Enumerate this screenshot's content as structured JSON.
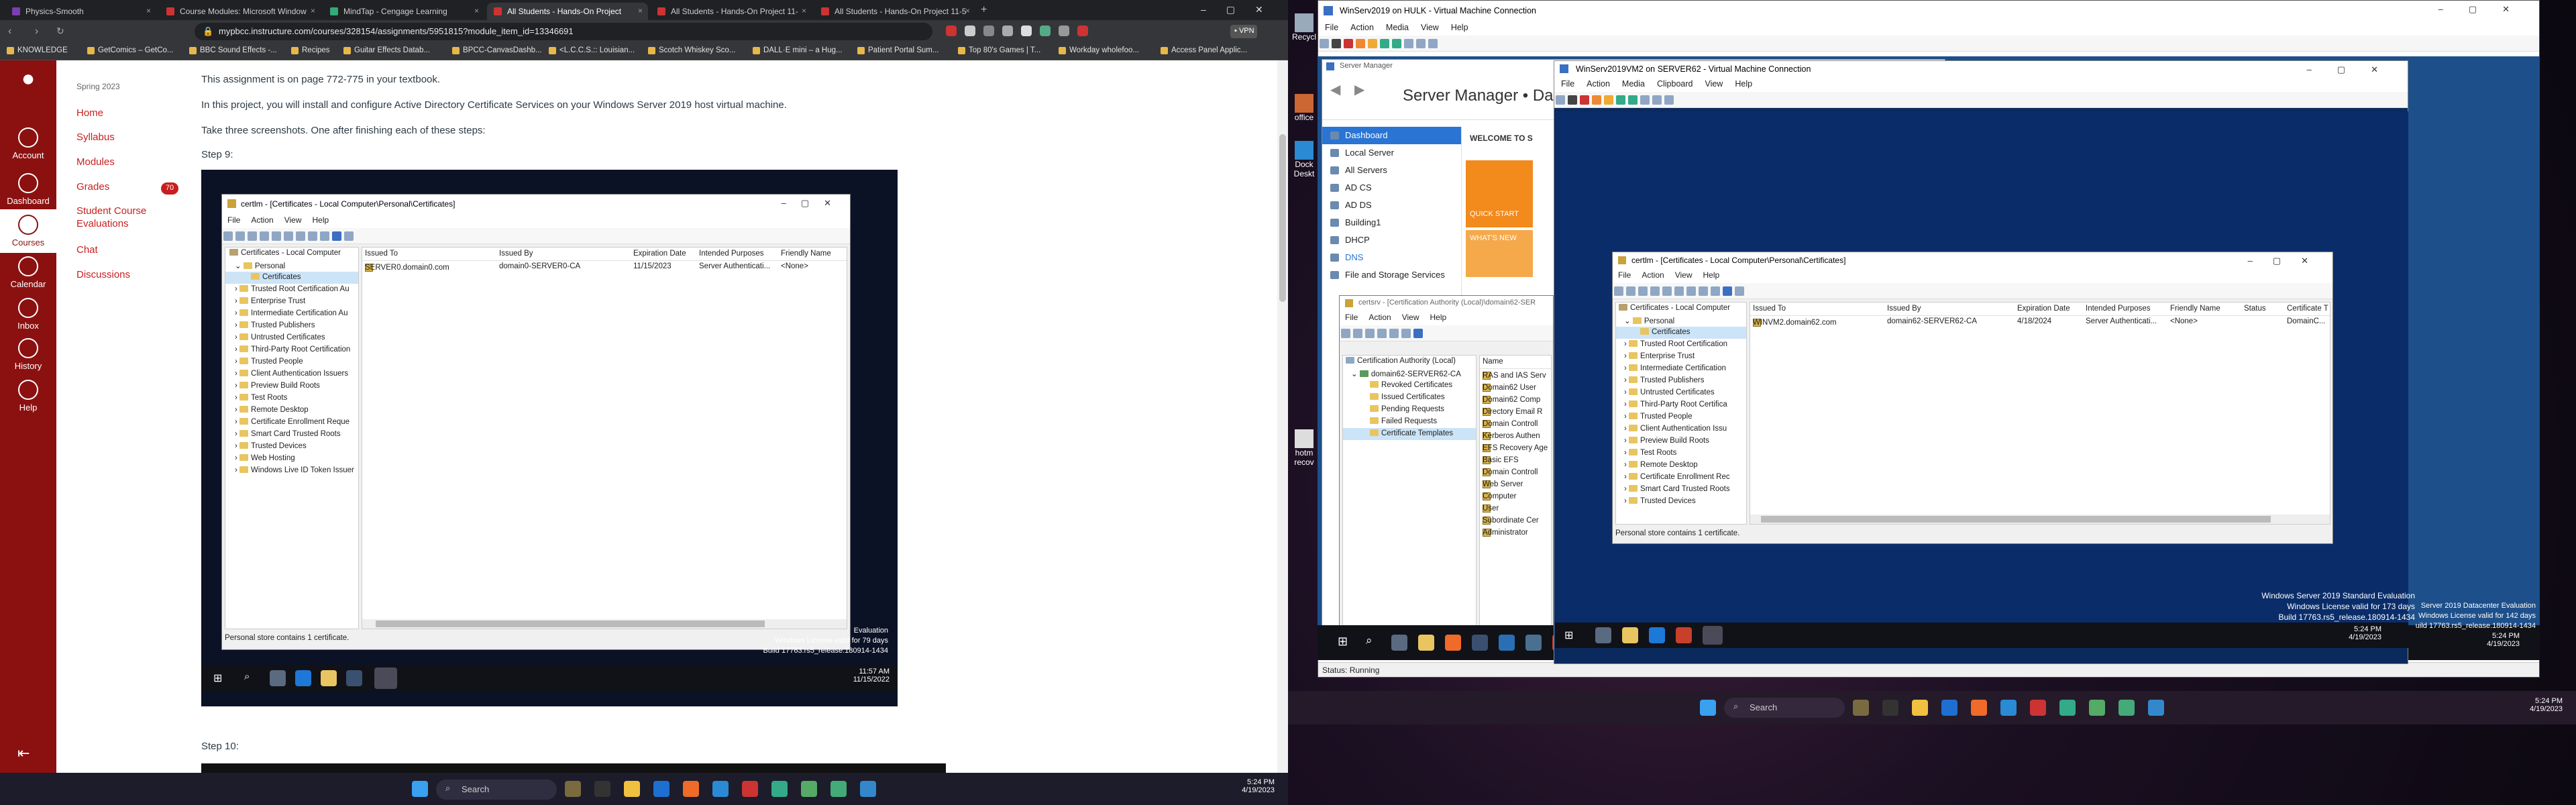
{
  "left_monitor": {
    "tabs": [
      {
        "label": "Physics-Smooth",
        "active": false
      },
      {
        "label": "Course Modules: Microsoft Window",
        "active": false
      },
      {
        "label": "MindTap - Cengage Learning",
        "active": false
      },
      {
        "label": "All Students - Hands-On Project",
        "active": true
      },
      {
        "label": "All Students - Hands-On Project 11-",
        "active": false
      },
      {
        "label": "All Students - Hands-On Project 11-5",
        "active": false
      }
    ],
    "url": "mypbcc.instructure.com/courses/328154/assignments/5951815?module_item_id=13346691",
    "bookmarks": [
      "KNOWLEDGE",
      "GetComics – GetCo...",
      "BBC Sound Effects -...",
      "Recipes",
      "Guitar Effects Datab...",
      "BPCC-CanvasDashb...",
      "<L.C.C.S.:: Louisian...",
      "Scotch Whiskey Sco...",
      "DALL·E mini – a Hug...",
      "Patient Portal Sum...",
      "Top 80's Games | T...",
      "Workday wholefoo...",
      "Access Panel Applic..."
    ],
    "canvas_nav": [
      {
        "label": "Account"
      },
      {
        "label": "Dashboard"
      },
      {
        "label": "Courses"
      },
      {
        "label": "Calendar"
      },
      {
        "label": "Inbox"
      },
      {
        "label": "History"
      },
      {
        "label": "Help"
      }
    ],
    "course_nav": {
      "term": "Spring 2023",
      "links": [
        "Home",
        "Syllabus",
        "Modules",
        "Grades",
        "Student Course Evaluations",
        "Chat",
        "Discussions"
      ],
      "grades_badge": "70"
    },
    "content": {
      "p1": "This assignment is on page 772-775 in your textbook.",
      "p2": "In this project, you will install and configure Active Directory Certificate Services on your Windows Server 2019 host virtual machine.",
      "p3": "Take three screenshots. One after finishing each of these steps:",
      "step9": "Step 9:",
      "step10": "Step 10:"
    },
    "embedded": {
      "title": "certlm - [Certificates - Local Computer\\Personal\\Certificates]",
      "menu": [
        "File",
        "Action",
        "View",
        "Help"
      ],
      "tree": [
        "Certificates - Local Computer",
        "Personal",
        "Certificates",
        "Trusted Root Certification Au",
        "Enterprise Trust",
        "Intermediate Certification Au",
        "Trusted Publishers",
        "Untrusted Certificates",
        "Third-Party Root Certification",
        "Trusted People",
        "Client Authentication Issuers",
        "Preview Build Roots",
        "Test Roots",
        "Remote Desktop",
        "Certificate Enrollment Reque",
        "Smart Card Trusted Roots",
        "Trusted Devices",
        "Web Hosting",
        "Windows Live ID Token Issuer"
      ],
      "columns": [
        "Issued To",
        "Issued By",
        "Expiration Date",
        "Intended Purposes",
        "Friendly Name"
      ],
      "row": {
        "issued_to": "SERVER0.domain0.com",
        "issued_by": "domain0-SERVER0-CA",
        "expires": "11/15/2023",
        "purposes": "Server Authenticati...",
        "friendly": "<None>"
      },
      "status": "Personal store contains 1 certificate.",
      "eval_lines": [
        "Windows License valid for 79 days",
        "Build 17763.rs5_release.180914-1434"
      ],
      "eval_top": "Evaluation",
      "clock_time": "11:57 AM",
      "clock_date": "11/15/2022"
    },
    "taskbar": {
      "search": "Search",
      "time": "5:24 PM",
      "date": "4/19/2023"
    }
  },
  "right_monitor": {
    "vm1_title": "WinServ2019 on HULK - Virtual Machine Connection",
    "vm1_menu": [
      "File",
      "Action",
      "Media",
      "View",
      "Help"
    ],
    "desktop_icons": [
      "Recycl",
      "office",
      "Dock Deskt",
      "hotm recov"
    ],
    "server_manager": {
      "window_title": "Server Manager",
      "heading": "Server Manager • Da",
      "welcome": "WELCOME TO S",
      "quick_start": "QUICK START",
      "whats_new": "WHAT'S NEW",
      "nav": [
        "Dashboard",
        "Local Server",
        "All Servers",
        "AD CS",
        "AD DS",
        "Building1",
        "DHCP",
        "DNS",
        "File and Storage Services"
      ]
    },
    "certsrv": {
      "title": "certsrv - [Certification Authority (Local)\\domain62-SER",
      "menu": [
        "File",
        "Action",
        "View",
        "Help"
      ],
      "tree": [
        "Certification Authority (Local)",
        "domain62-SERVER62-CA",
        "Revoked Certificates",
        "Issued Certificates",
        "Pending Requests",
        "Failed Requests",
        "Certificate Templates"
      ],
      "name_header": "Name",
      "names": [
        "RAS and IAS Serv",
        "Domain62 User",
        "Domain62 Comp",
        "Directory Email R",
        "Domain Controll",
        "Kerberos Authen",
        "EFS Recovery Age",
        "Basic EFS",
        "Domain Controll",
        "Web Server",
        "Computer",
        "User",
        "Subordinate Cer",
        "Administrator"
      ]
    },
    "vm2": {
      "title": "WinServ2019VM2 on SERVER62 - Virtual Machine Connection",
      "menu": [
        "File",
        "Action",
        "Media",
        "Clipboard",
        "View",
        "Help"
      ]
    },
    "certlm2": {
      "title": "certlm - [Certificates - Local Computer\\Personal\\Certificates]",
      "menu": [
        "File",
        "Action",
        "View",
        "Help"
      ],
      "tree": [
        "Certificates - Local Computer",
        "Personal",
        "Certificates",
        "Trusted Root Certification",
        "Enterprise Trust",
        "Intermediate Certification",
        "Trusted Publishers",
        "Untrusted Certificates",
        "Third-Party Root Certifica",
        "Trusted People",
        "Client Authentication Issu",
        "Preview Build Roots",
        "Test Roots",
        "Remote Desktop",
        "Certificate Enrollment Rec",
        "Smart Card Trusted Roots",
        "Trusted Devices"
      ],
      "columns": [
        "Issued To",
        "Issued By",
        "Expiration Date",
        "Intended Purposes",
        "Friendly Name",
        "Status",
        "Certificate T"
      ],
      "row": {
        "issued_to": "WINVM2.domain62.com",
        "issued_by": "domain62-SERVER62-CA",
        "expires": "4/18/2024",
        "purposes": "Server Authenticati...",
        "friendly": "<None>",
        "status": "",
        "template": "DomainC..."
      },
      "status": "Personal store contains 1 certificate."
    },
    "vm2_eval": [
      "Windows Server 2019 Standard Evaluation",
      "Windows License valid for 173 days",
      "Build 17763.rs5_release.180914-1434"
    ],
    "vm2_clock": {
      "time": "5:24 PM",
      "date": "4/19/2023"
    },
    "vm1_eval": [
      "Server 2019 Datacenter Evaluation",
      "Windows License valid for 142 days",
      "uild 17763.rs5_release.180914-1434"
    ],
    "vm1_clock": {
      "time": "5:24 PM",
      "date": "4/19/2023"
    },
    "vm1_status": "Status: Running",
    "taskbar": {
      "search": "Search",
      "time": "5:24 PM",
      "date": "4/19/2023"
    }
  }
}
